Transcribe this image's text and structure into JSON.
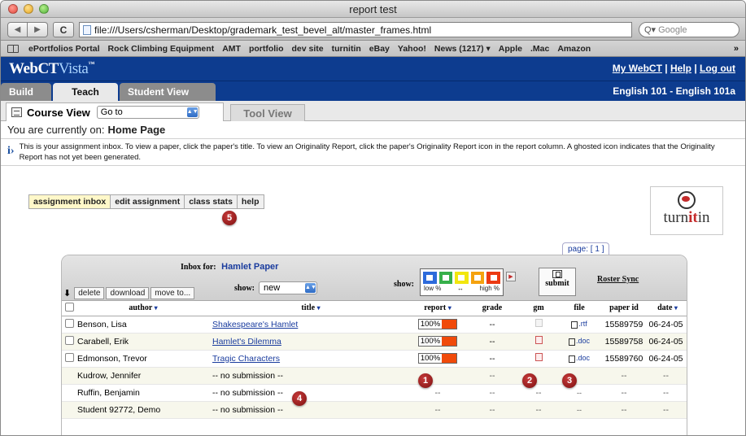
{
  "window": {
    "title": "report test"
  },
  "browser": {
    "url": "file:///Users/csherman/Desktop/grademark_test_bevel_alt/master_frames.html",
    "search_placeholder": "Google",
    "search_icon": "Q▾",
    "back_icon": "◀",
    "forward_icon": "▶",
    "reload_icon": "C",
    "bookmarks": [
      "ePortfolios Portal",
      "Rock Climbing Equipment",
      "AMT",
      "portfolio",
      "dev site",
      "turnitin",
      "eBay",
      "Yahoo!",
      "News (1217) ▾",
      "Apple",
      ".Mac",
      "Amazon"
    ],
    "bookmarks_more": "»"
  },
  "webct": {
    "logo_main": "WebCT",
    "logo_vista": "Vista",
    "logo_tm": "™",
    "links": [
      "My WebCT",
      "Help",
      "Log out"
    ],
    "link_sep": "|",
    "tabs": [
      "Build",
      "Teach",
      "Student View"
    ],
    "course": "English 101 - English 101a",
    "course_view": "Course View",
    "goto": "Go to",
    "tool_view": "Tool View",
    "location_prefix": "You are currently on:",
    "location": "Home Page",
    "info": "This is your assignment inbox. To view a paper, click the paper's title. To view an Originality Report, click the paper's Originality Report icon in the report column. A ghosted icon indicates that the Originality Report has not yet been generated.",
    "info_icon": "i›"
  },
  "inbox": {
    "tabs": [
      "assignment inbox",
      "edit assignment",
      "class stats",
      "help"
    ],
    "page_label": "page: [ 1 ]",
    "inbox_for_label": "Inbox for:",
    "assignment": "Hamlet Paper",
    "actions": [
      "delete",
      "download",
      "move to..."
    ],
    "show_label": "show:",
    "show_value": "new",
    "show_label2": "show:",
    "scale_low": "low %",
    "scale_arrow": "↔",
    "scale_high": "high %",
    "swatch_colors": [
      "#2d6bdb",
      "#37b04a",
      "#f2e60f",
      "#f5a20f",
      "#ec3a12"
    ],
    "submit_label": "submit",
    "roster_sync": "Roster Sync",
    "select_arrow": "⬇",
    "sort_arrow": "▾",
    "columns": [
      "author",
      "title",
      "report",
      "grade",
      "gm",
      "file",
      "paper id",
      "date"
    ],
    "rows": [
      {
        "author": "Benson, Lisa",
        "title": "Shakespeare's Hamlet",
        "report": "100%",
        "grade": "--",
        "gm": "ghost",
        "file": ".rtf",
        "paper_id": "15589759",
        "date": "06-24-05"
      },
      {
        "author": "Carabell, Erik",
        "title": "Hamlet's Dilemma",
        "report": "100%",
        "grade": "--",
        "gm": "icon",
        "file": ".doc",
        "paper_id": "15589758",
        "date": "06-24-05"
      },
      {
        "author": "Edmonson, Trevor",
        "title": "Tragic Characters",
        "report": "100%",
        "grade": "--",
        "gm": "icon",
        "file": ".doc",
        "paper_id": "15589760",
        "date": "06-24-05"
      },
      {
        "author": "Kudrow, Jennifer",
        "title": "-- no submission --",
        "report": "",
        "grade": "--",
        "gm": "",
        "file": "",
        "paper_id": "--",
        "date": "--"
      },
      {
        "author": "Ruffin, Benjamin",
        "title": "-- no submission --",
        "report": "--",
        "grade": "--",
        "gm": "--",
        "file": "--",
        "paper_id": "--",
        "date": "--"
      },
      {
        "author": "Student 92772, Demo",
        "title": "-- no submission --",
        "report": "--",
        "grade": "--",
        "gm": "--",
        "file": "--",
        "paper_id": "--",
        "date": "--"
      }
    ]
  },
  "callouts": [
    "1",
    "2",
    "3",
    "4",
    "5"
  ],
  "turnitin": {
    "logo_a": "turn",
    "logo_b": "it",
    "logo_c": "in"
  }
}
